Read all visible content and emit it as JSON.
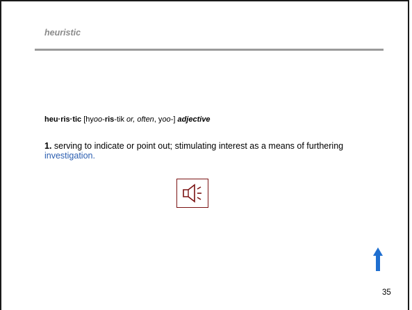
{
  "slide": {
    "title": "heuristic",
    "page_number": "35"
  },
  "entry": {
    "headword": "heu·ris·tic",
    "pron_open": " [hy",
    "pron_oo1": "oo",
    "pron_dash1": "-",
    "pron_ris": "ris",
    "pron_tik": "-tik ",
    "pron_or_often": "or, often",
    "pron_comma": ", y",
    "pron_oo2": "oo",
    "pron_close": "-] ",
    "pos": "adjective"
  },
  "definition": {
    "number": "1.",
    "text": " serving to indicate or point out; stimulating interest as a means of furthering ",
    "link_text": "investigation."
  },
  "icons": {
    "speaker": "speaker-icon",
    "arrow": "up-arrow-icon"
  },
  "colors": {
    "link": "#2a5db0",
    "speaker_border": "#7a1212",
    "arrow": "#1f6fd0",
    "title": "#8a8a8a"
  }
}
